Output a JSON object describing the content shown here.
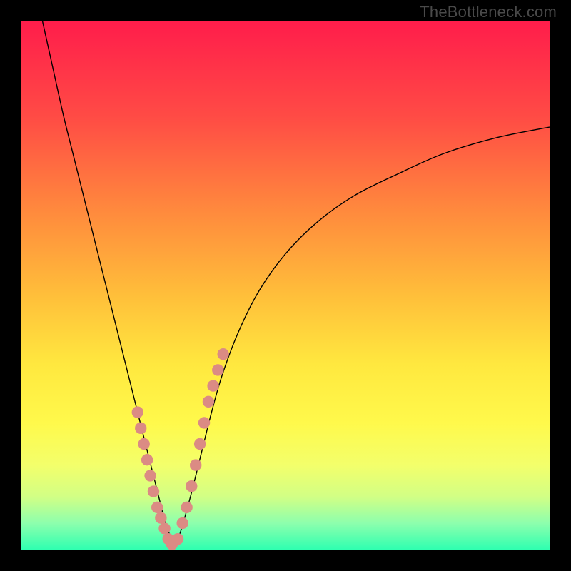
{
  "watermark": "TheBottleneck.com",
  "colors": {
    "gradient_stops": [
      {
        "offset": 0,
        "color": "#ff1d4b"
      },
      {
        "offset": 18,
        "color": "#ff4b45"
      },
      {
        "offset": 36,
        "color": "#ff8a3d"
      },
      {
        "offset": 52,
        "color": "#ffbf3a"
      },
      {
        "offset": 65,
        "color": "#ffe83f"
      },
      {
        "offset": 76,
        "color": "#fff94b"
      },
      {
        "offset": 84,
        "color": "#f3ff6b"
      },
      {
        "offset": 90,
        "color": "#d2ff85"
      },
      {
        "offset": 95,
        "color": "#8dffad"
      },
      {
        "offset": 100,
        "color": "#2fffb0"
      }
    ],
    "curve": "#000000",
    "dot_fill": "#db8b84",
    "frame": "#000000"
  },
  "chart_data": {
    "type": "line",
    "title": "",
    "xlabel": "",
    "ylabel": "",
    "xlim": [
      0,
      100
    ],
    "ylim": [
      0,
      100
    ],
    "grid": false,
    "series": [
      {
        "name": "left-curve",
        "x": [
          4,
          6,
          8,
          10,
          12,
          14,
          16,
          18,
          20,
          22,
          24,
          26,
          27,
          28,
          29
        ],
        "y": [
          100,
          91,
          82,
          74,
          66,
          58,
          50,
          42,
          34,
          26,
          18,
          10,
          6,
          3,
          1
        ]
      },
      {
        "name": "right-curve",
        "x": [
          29,
          30,
          32,
          34,
          36,
          38,
          41,
          45,
          50,
          56,
          63,
          71,
          80,
          90,
          100
        ],
        "y": [
          1,
          3,
          10,
          18,
          26,
          33,
          41,
          49,
          56,
          62,
          67,
          71,
          75,
          78,
          80
        ]
      }
    ],
    "points": [
      {
        "name": "left-dots",
        "x": [
          22.0,
          22.6,
          23.2,
          23.8,
          24.4,
          25.0,
          25.7,
          26.4,
          27.1,
          27.8,
          28.5
        ],
        "y": [
          26,
          23,
          20,
          17,
          14,
          11,
          8,
          6,
          4,
          2,
          1
        ]
      },
      {
        "name": "right-dots",
        "x": [
          29.6,
          30.5,
          31.3,
          32.2,
          33.0,
          33.8,
          34.6,
          35.4,
          36.3,
          37.2,
          38.2
        ],
        "y": [
          2,
          5,
          8,
          12,
          16,
          20,
          24,
          28,
          31,
          34,
          37
        ]
      }
    ],
    "annotations": []
  }
}
